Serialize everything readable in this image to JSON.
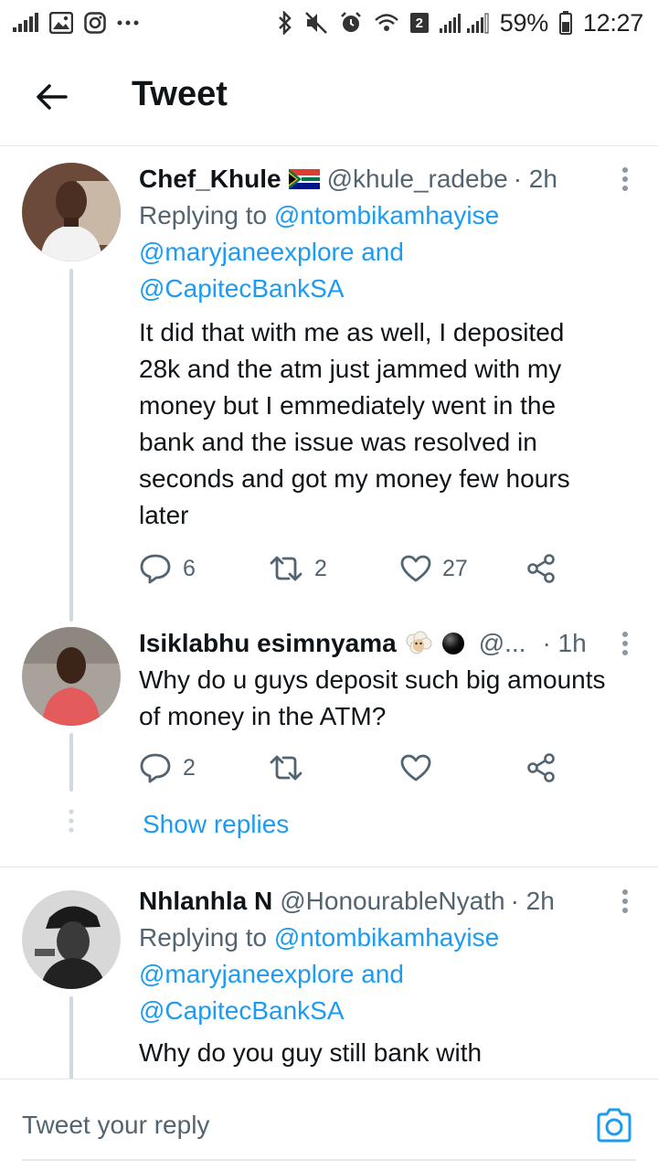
{
  "status_bar": {
    "battery": "59%",
    "time": "12:27",
    "sim_badge": "2",
    "icons_left": [
      "signal-bars-icon",
      "gallery-icon",
      "instagram-icon",
      "more-dots-icon"
    ],
    "icons_right": [
      "bluetooth-icon",
      "mute-icon",
      "alarm-icon",
      "wifi-icon",
      "signal-icon",
      "battery-icon"
    ]
  },
  "header": {
    "title": "Tweet",
    "back_icon": "arrow-left-icon"
  },
  "colors": {
    "link": "#1d9bf0",
    "muted": "#536471",
    "text": "#0f1419",
    "divider": "#e6e9ec"
  },
  "tweets": [
    {
      "name": "Chef_Khule",
      "emoji": "south-africa-flag",
      "handle": "@khule_radebe",
      "time": "· 2h",
      "replying_prefix": "Replying to",
      "mention1": "@ntombikamhayise",
      "mention2": "@maryjaneexplore",
      "and_text": "and",
      "mention3": "@CapitecBankSA",
      "lines": [
        "It did that with me as well, I deposited",
        "28k and the atm just jammed with my",
        "money but I emmediately went in the",
        "bank and the issue was resolved in",
        "seconds and got my money few hours",
        "later"
      ],
      "replies": "6",
      "retweets": "2",
      "likes": "27"
    },
    {
      "name": "Isiklabhu esimnyama",
      "emoji": "sheep-emoji",
      "emoji2": "black-circle",
      "handle": "@...",
      "time": "· 1h",
      "lines": [
        "Why do u guys deposit such big amounts",
        "of money in the ATM?"
      ],
      "replies": "2",
      "retweets": "",
      "likes": ""
    },
    {
      "name": "Nhlanhla N",
      "handle": "@HonourableNyath",
      "time": "· 2h",
      "replying_prefix": "Replying to",
      "mention1": "@ntombikamhayise",
      "mention2": "@maryjaneexplore",
      "and_text": "and",
      "mention3": "@CapitecBankSA",
      "lines": [
        "Why do you guy still bank with"
      ]
    }
  ],
  "show_replies": "Show replies",
  "reply_bar": {
    "placeholder": "Tweet your reply",
    "camera_icon": "camera-icon"
  }
}
